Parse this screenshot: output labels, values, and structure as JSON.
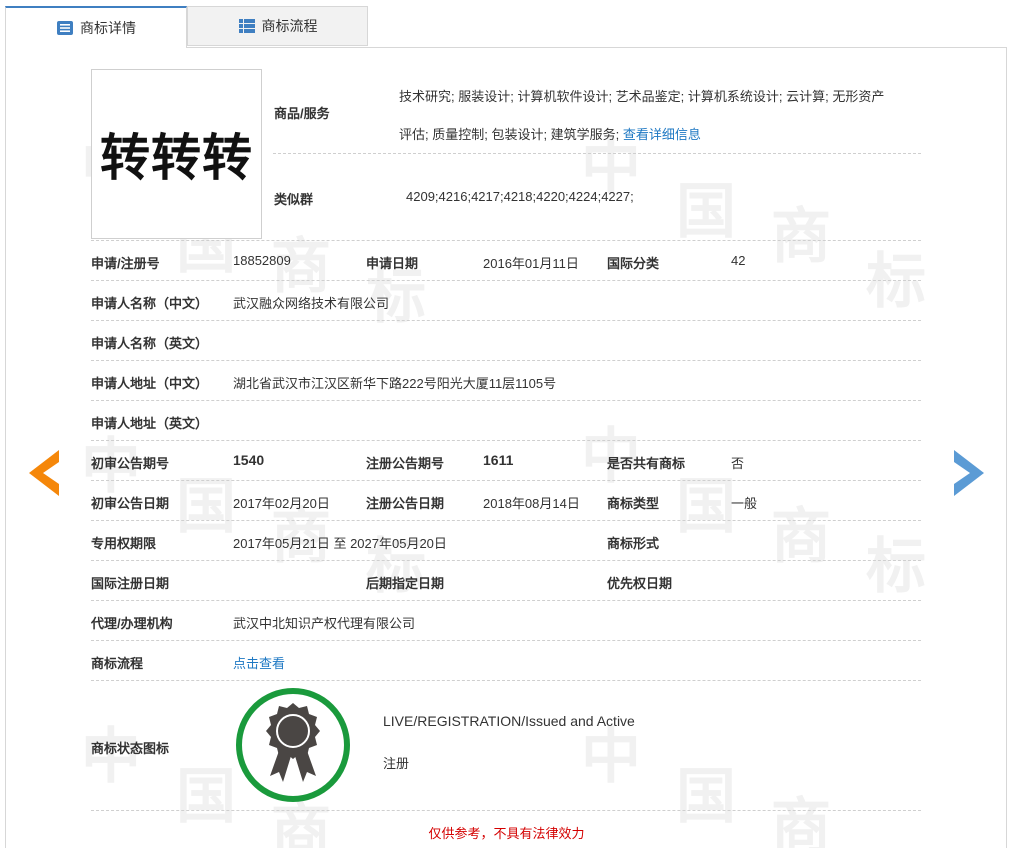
{
  "tabs": [
    {
      "label": "商标详情",
      "icon": "list-icon",
      "active": true
    },
    {
      "label": "商标流程",
      "icon": "grid-icon",
      "active": false
    }
  ],
  "watermark": {
    "chars": [
      "中",
      "国",
      "商",
      "标"
    ]
  },
  "trademark": {
    "logo_text": "转转转",
    "goods_label": "商品/服务",
    "goods_line1": "技术研究; 服装设计; 计算机软件设计; 艺术品鉴定; 计算机系统设计; 云计算; 无形资产",
    "goods_line2": "评估; 质量控制; 包装设计; 建筑学服务;",
    "goods_link": "查看详细信息",
    "similar_label": "类似群",
    "similar_value": "4209;4216;4217;4218;4220;4224;4227;"
  },
  "fields": {
    "reg_no_label": "申请/注册号",
    "reg_no": "18852809",
    "apply_date_label": "申请日期",
    "apply_date": "2016年01月11日",
    "intl_class_label": "国际分类",
    "intl_class": "42",
    "applicant_cn_label": "申请人名称（中文）",
    "applicant_cn": "武汉融众网络技术有限公司",
    "applicant_en_label": "申请人名称（英文）",
    "applicant_en": "",
    "address_cn_label": "申请人地址（中文）",
    "address_cn": "湖北省武汉市江汉区新华下路222号阳光大厦11层1105号",
    "address_en_label": "申请人地址（英文）",
    "address_en": "",
    "prelim_no_label": "初审公告期号",
    "prelim_no": "1540",
    "reg_pub_no_label": "注册公告期号",
    "reg_pub_no": "1611",
    "shared_label": "是否共有商标",
    "shared": "否",
    "prelim_date_label": "初审公告日期",
    "prelim_date": "2017年02月20日",
    "reg_pub_date_label": "注册公告日期",
    "reg_pub_date": "2018年08月14日",
    "tm_type_label": "商标类型",
    "tm_type": "一般",
    "validity_label": "专用权期限",
    "validity": "2017年05月21日 至 2027年05月20日",
    "tm_form_label": "商标形式",
    "tm_form": "",
    "intl_reg_date_label": "国际注册日期",
    "intl_reg_date": "",
    "later_date_label": "后期指定日期",
    "later_date": "",
    "priority_label": "优先权日期",
    "priority": "",
    "agent_label": "代理/办理机构",
    "agent": "武汉中北知识产权代理有限公司",
    "process_label": "商标流程",
    "process_link": "点击查看"
  },
  "status": {
    "label": "商标状态图标",
    "icon": "award-ribbon-icon",
    "text_en": "LIVE/REGISTRATION/Issued and Active",
    "text_cn": "注册",
    "ring_color": "#1a9a3c"
  },
  "disclaimer": "仅供参考，不具有法律效力",
  "colors": {
    "accent": "#3f7fc1",
    "link": "#1e78c3",
    "prev_arrow": "#f5870a",
    "next_arrow": "#5b9bd5",
    "disclaimer": "#d40000"
  }
}
